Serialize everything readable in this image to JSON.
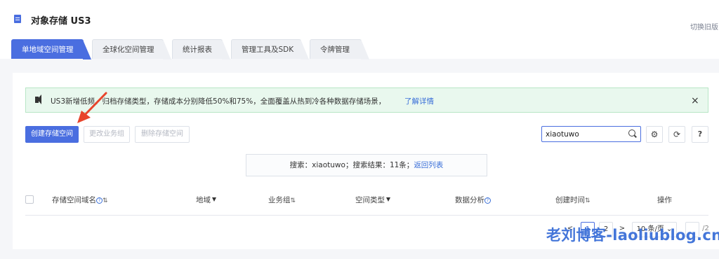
{
  "header": {
    "title": "对象存储 US3",
    "switch_label": "切换旧版"
  },
  "tabs": [
    {
      "label": "单地域空间管理"
    },
    {
      "label": "全球化空间管理"
    },
    {
      "label": "统计报表"
    },
    {
      "label": "管理工具及SDK"
    },
    {
      "label": "令牌管理"
    }
  ],
  "notice": {
    "text": "US3新增低频、归档存储类型，存储成本分别降低50%和75%，全面覆盖从热到冷各种数据存储场景，",
    "link": "了解详情",
    "close": "×"
  },
  "toolbar": {
    "create": "创建存储空间",
    "change_group": "更改业务组",
    "delete": "删除存储空间",
    "search_value": "xiaotuwo",
    "settings_icon": "gear-icon",
    "refresh_icon": "refresh-icon",
    "help_icon": "help-icon",
    "settings_glyph": "⚙",
    "refresh_glyph": "⟳",
    "help_glyph": "?"
  },
  "search_result": {
    "text": "搜索：xiaotuwo；搜索结果：11条；",
    "link": "返回列表"
  },
  "table": {
    "columns": [
      {
        "label": "存储空间域名"
      },
      {
        "label": "地域"
      },
      {
        "label": "业务组"
      },
      {
        "label": "空间类型"
      },
      {
        "label": "数据分析"
      },
      {
        "label": "创建时间"
      },
      {
        "label": "操作"
      }
    ]
  },
  "pager": {
    "prev": "<",
    "page1": "1",
    "page2": "2",
    "next": ">",
    "page_size": "10 条/页",
    "total": "/2"
  },
  "watermark": "老刘博客-laoliublog.cn",
  "colors": {
    "accent": "#4a6ee0",
    "link": "#3a6fd8",
    "notice_bg": "#e9f8ee",
    "annotation_arrow": "#e8452c"
  }
}
